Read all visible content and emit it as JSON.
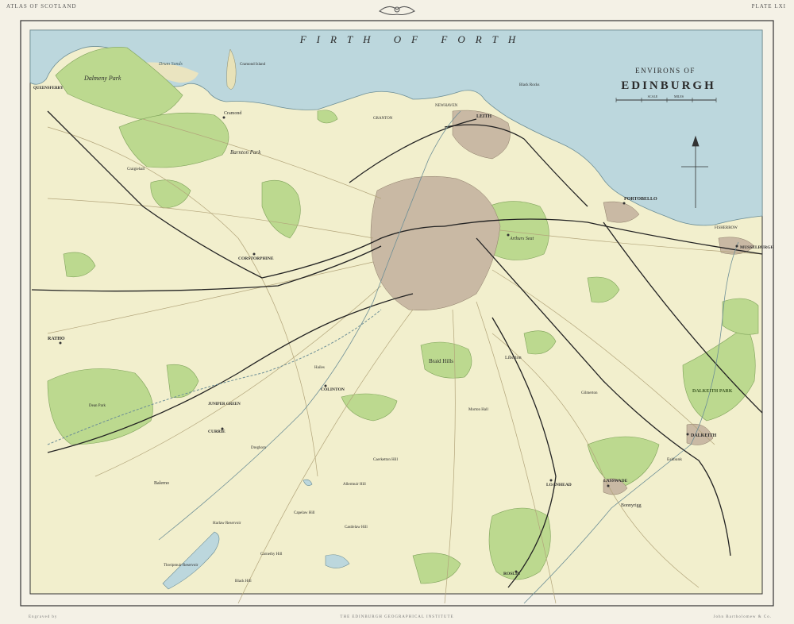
{
  "header": {
    "left": "ATLAS OF SCOTLAND",
    "right": "PLATE LXI"
  },
  "footer": {
    "left": "Engraved by",
    "center": "THE EDINBURGH GEOGRAPHICAL INSTITUTE",
    "right": "John Bartholomew & Co."
  },
  "title": {
    "line1": "ENVIRONS OF",
    "line2": "EDINBURGH",
    "scale_left": "SCALE",
    "scale_right": "MILES"
  },
  "sea_label": "FIRTH OF FORTH",
  "colors": {
    "sea": "#bcd7dd",
    "land": "#f2efcd",
    "wood": "#bcd98f",
    "city": "#c9b9a4",
    "frame": "#333333",
    "rail": "#222222"
  },
  "places": {
    "edinburgh_castle": "Arthurs Seat",
    "portobello": "PORTOBELLO",
    "musselburgh": "MUSSELBURGH",
    "dalkeith": "DALKEITH",
    "dalkeith_park": "DALKEITH PARK",
    "leith": "LEITH",
    "granton": "GRANTON",
    "newhaven": "NEWHAVEN",
    "cramond": "Cramond",
    "cramond_island": "Cramond Island",
    "drum_sands": "Drum Sands",
    "dalmeny_park": "Dalmeny Park",
    "queensferry": "QUEENSFERRY",
    "barnton_park": "Barnton Park",
    "corstorphine": "CORSTORPHINE",
    "ratho": "RATHO",
    "currie": "CURRIE",
    "balerno": "Balerno",
    "juniper_green": "JUNIPER GREEN",
    "colinton": "COLINTON",
    "braid_hills": "Braid Hills",
    "liberton": "Liberton",
    "loanhead": "LOANHEAD",
    "lasswade": "LASSWADE",
    "bonnyrigg": "Bonnyrigg",
    "roslin": "ROSLIN",
    "eskbank": "Eskbank",
    "caerketton": "Caerketton Hill",
    "allermuir": "Allermuir Hill",
    "castlelaw": "Castlelaw Hill",
    "carnethy": "Carnethy Hill",
    "capelaw": "Capelaw Hill",
    "black_hill": "Black Hill",
    "threipmuir": "Threipmuir Reservoir",
    "harlaw": "Harlaw Reservoir",
    "mortonhall": "Morton Hall",
    "dean_park": "Dean Park",
    "craigiehall": "Craigiehall",
    "black_rocks": "Black Rocks",
    "fisherrow": "FISHERROW",
    "gilmerton": "Gilmerton",
    "dreghorn": "Dreghorn",
    "hailes": "Hailes"
  }
}
